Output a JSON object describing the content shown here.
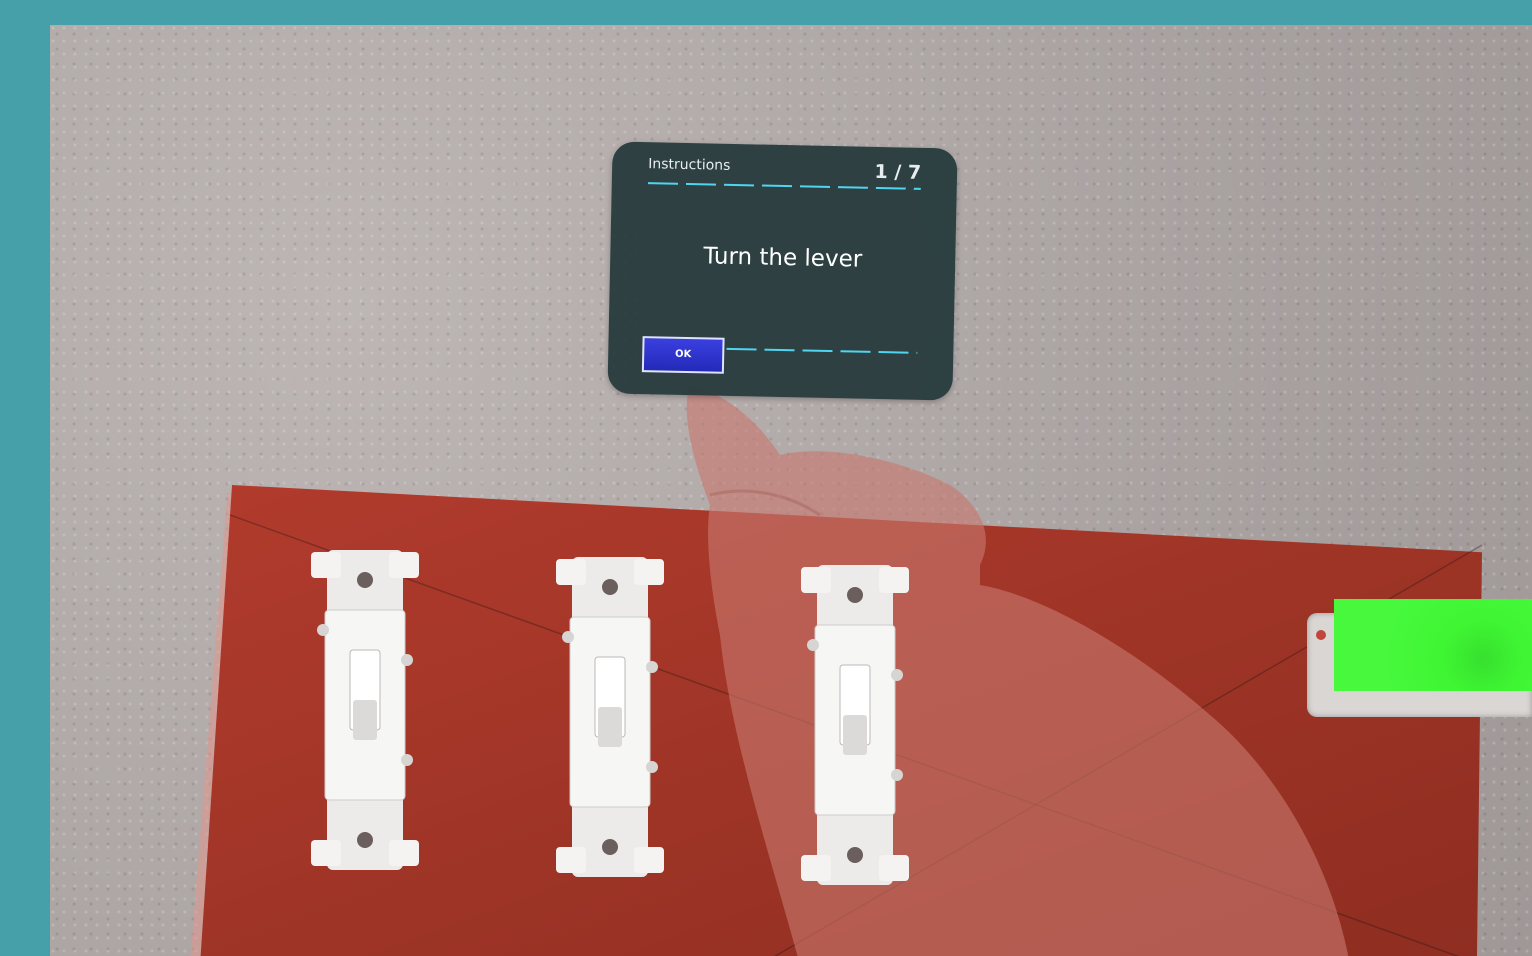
{
  "instruction_panel": {
    "title": "Instructions",
    "step_counter": "1 / 7",
    "message": "Turn the lever",
    "ok_label": "OK"
  },
  "scene": {
    "switch_count": 3,
    "indicator_state": "on",
    "colors": {
      "frame": "#46a0aa",
      "board": "#a3362a",
      "panel": "#24383a",
      "accent_dash": "#4fd5f0",
      "ok_button": "#2e34d0",
      "indicator": "#3ff633"
    }
  }
}
